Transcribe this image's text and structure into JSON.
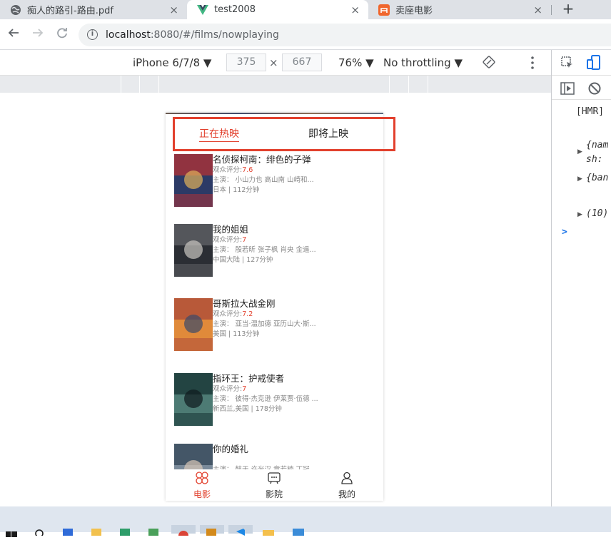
{
  "browser": {
    "tabs": [
      {
        "title": "痴人的路引-路由.pdf",
        "icon": "globe-icon",
        "active": false
      },
      {
        "title": "test2008",
        "icon": "vue-logo-icon",
        "active": true
      },
      {
        "title": "卖座电影",
        "icon": "maizuo-logo-icon",
        "active": false
      }
    ],
    "new_tab": "+",
    "close": "×",
    "url_host": "localhost",
    "url_rest": ":8080/#/films/nowplaying"
  },
  "device_toolbar": {
    "device": "iPhone 6/7/8 ▼",
    "width": "375",
    "times": "×",
    "height": "667",
    "zoom": "76% ▼",
    "throttling": "No throttling ▼"
  },
  "devtools": {
    "console": [
      "[HMR]",
      "{nam",
      "sh:",
      "{ban",
      "(10)"
    ],
    "prompt": ">"
  },
  "app": {
    "tabs": {
      "now_playing": "正在热映",
      "coming_soon": "即将上映"
    },
    "films": [
      {
        "title": "名侦探柯南：绯色的子弹",
        "score_label": "观众评分:",
        "score": "7.6",
        "cast": "主演：  小山力也 高山南 山崎和...",
        "meta": "日本 | 112分钟",
        "poster_colors": [
          "#a3323a",
          "#2c3a66",
          "#e0b05a"
        ]
      },
      {
        "title": "我的姐姐",
        "score_label": "观众评分:",
        "score": "7",
        "cast": "主演：  殷若昕 张子枫 肖央 金遥...",
        "meta": "中国大陆 | 127分钟",
        "poster_colors": [
          "#5c5d63",
          "#2b2e34",
          "#c9c6c0"
        ]
      },
      {
        "title": "哥斯拉大战金刚",
        "score_label": "观众评分:",
        "score": "7.2",
        "cast": "主演：  亚当·温加德 亚历山大·斯...",
        "meta": "美国 | 113分钟",
        "poster_colors": [
          "#b0503a",
          "#e08a3a",
          "#3a4a6a"
        ]
      },
      {
        "title": "指环王：护戒使者",
        "score_label": "观众评分:",
        "score": "7",
        "cast": "主演：  彼得·杰克逊 伊莱贾·伍德 ...",
        "meta": "新西兰,美国 | 178分钟",
        "poster_colors": [
          "#1c3b3a",
          "#4d7b74",
          "#0e1a1e"
        ]
      },
      {
        "title": "你的婚礼",
        "score_label": "",
        "score": "",
        "cast": "主演：  韩天 许光汉 章若楠 丁冠...",
        "meta": "",
        "poster_colors": [
          "#3b4c5e",
          "#7a8a9a",
          "#d9c8b8"
        ]
      }
    ],
    "bottom_nav": [
      {
        "label": "电影",
        "icon": "film-icon",
        "active": true
      },
      {
        "label": "影院",
        "icon": "cinema-icon",
        "active": false
      },
      {
        "label": "我的",
        "icon": "user-icon",
        "active": false
      }
    ]
  },
  "colors": {
    "accent": "#e2402d",
    "highlight_border": "#e2402d"
  }
}
